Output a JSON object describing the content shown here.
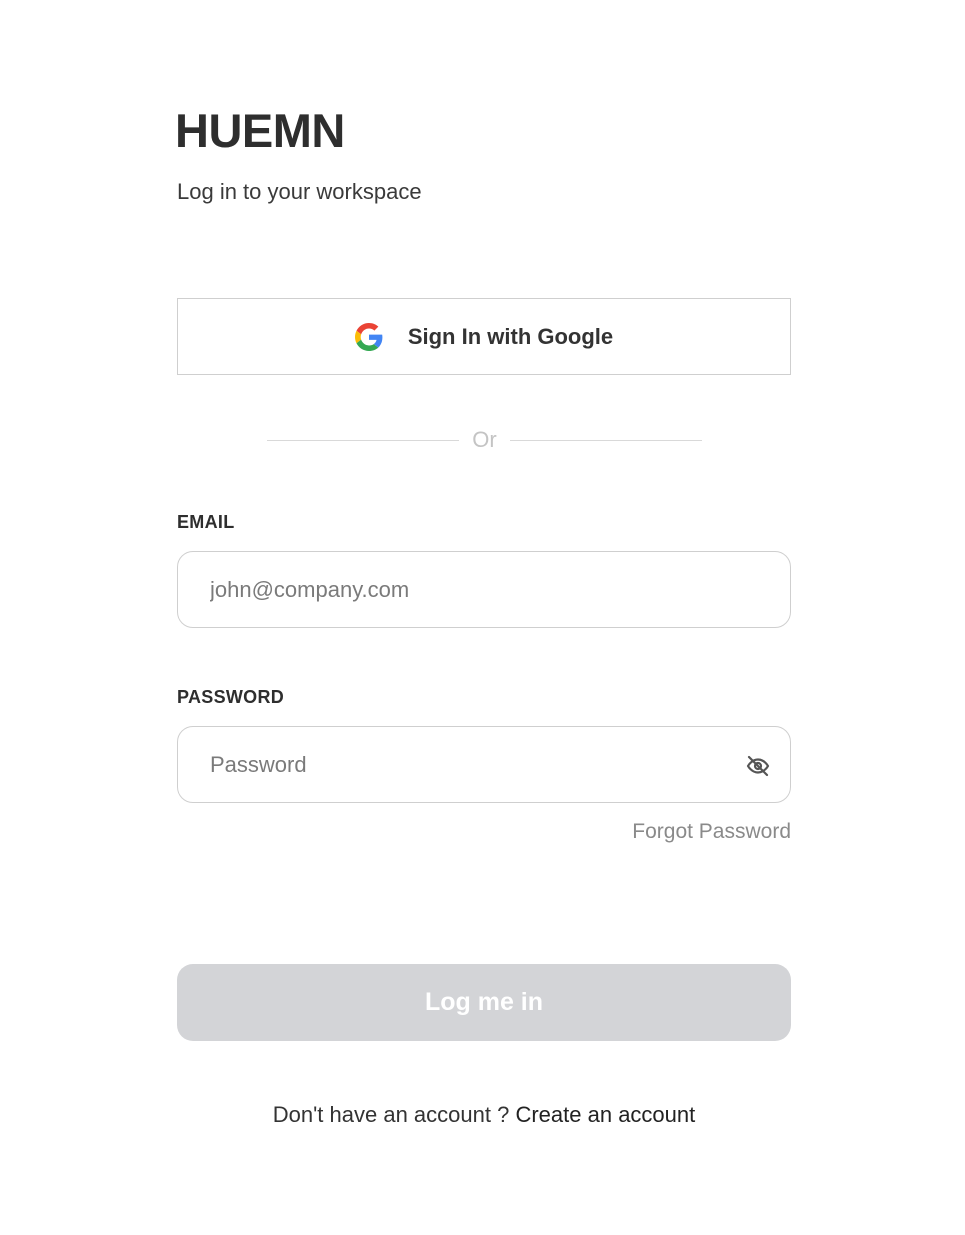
{
  "brand": {
    "logo_text": "HUEMN",
    "subtitle": "Log in to your workspace"
  },
  "google_signin": {
    "label": "Sign In with Google",
    "icon": "google-icon"
  },
  "divider": {
    "text": "Or"
  },
  "email": {
    "label": "EMAIL",
    "value": "",
    "placeholder": "john@company.com"
  },
  "password": {
    "label": "PASSWORD",
    "value": "",
    "placeholder": "Password",
    "toggle_icon": "eye-off-icon"
  },
  "forgot_password": {
    "label": "Forgot Password"
  },
  "login_button": {
    "label": "Log me in",
    "background": "#d3d4d7"
  },
  "signup": {
    "prompt": "Don't have an account ?",
    "link_label": "Create an account"
  }
}
